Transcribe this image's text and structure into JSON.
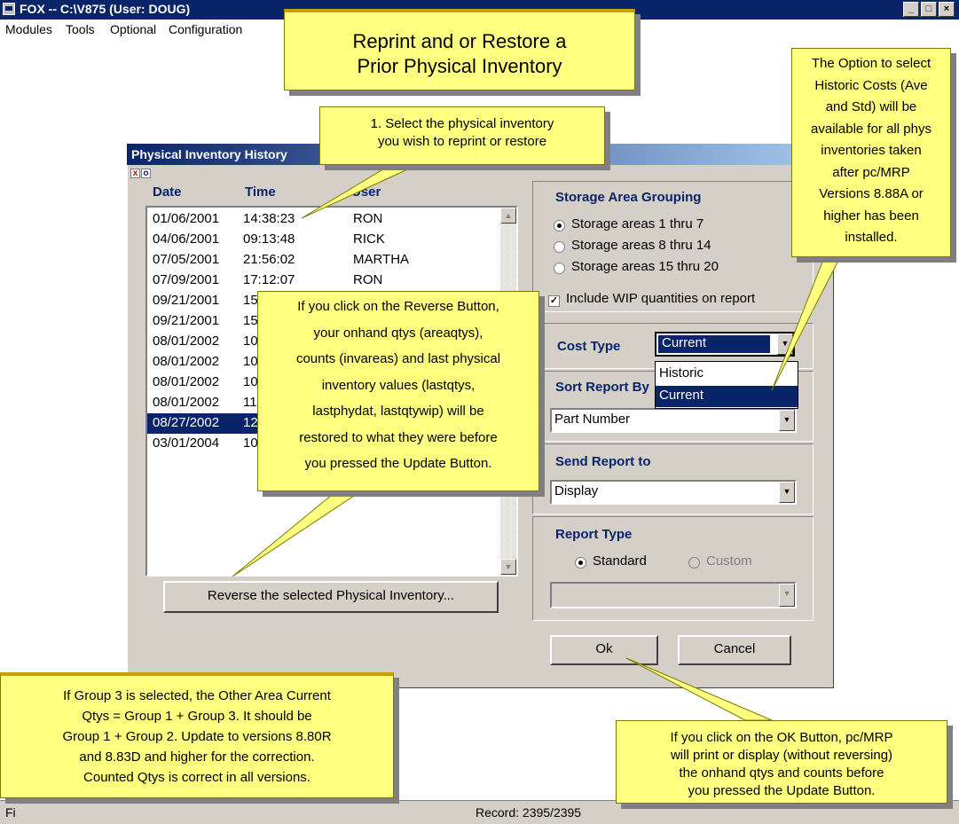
{
  "window": {
    "title": "FOX -- C:\\V875  (User: DOUG)"
  },
  "menu": {
    "items": [
      "Modules",
      "Tools",
      "Optional",
      "Configuration"
    ]
  },
  "dialog": {
    "title": "Physical Inventory History",
    "columns": {
      "date": "Date",
      "time": "Time",
      "user": "User"
    },
    "rows": [
      {
        "date": "01/06/2001",
        "time": "14:38:23",
        "user": "RON"
      },
      {
        "date": "04/06/2001",
        "time": "09:13:48",
        "user": "RICK"
      },
      {
        "date": "07/05/2001",
        "time": "21:56:02",
        "user": "MARTHA"
      },
      {
        "date": "07/09/2001",
        "time": "17:12:07",
        "user": "RON"
      },
      {
        "date": "09/21/2001",
        "time": "15",
        "user": ""
      },
      {
        "date": "09/21/2001",
        "time": "15",
        "user": ""
      },
      {
        "date": "08/01/2002",
        "time": "10",
        "user": ""
      },
      {
        "date": "08/01/2002",
        "time": "10",
        "user": ""
      },
      {
        "date": "08/01/2002",
        "time": "10",
        "user": ""
      },
      {
        "date": "08/01/2002",
        "time": "11",
        "user": ""
      },
      {
        "date": "08/27/2002",
        "time": "12",
        "user": ""
      },
      {
        "date": "03/01/2004",
        "time": "10",
        "user": ""
      }
    ],
    "selected_row": 10,
    "reverse_button": "Reverse the selected Physical Inventory...",
    "storage": {
      "heading": "Storage Area Grouping",
      "options": [
        "Storage areas 1 thru 7",
        "Storage areas 8 thru 14",
        "Storage areas 15 thru 20"
      ],
      "selected": 0
    },
    "include_wip": {
      "label": "Include WIP quantities on report",
      "checked": true
    },
    "cost_type": {
      "label": "Cost Type",
      "value": "Current",
      "options": [
        "Historic",
        "Current"
      ]
    },
    "sort": {
      "heading": "Sort Report By",
      "value": "Part Number"
    },
    "send": {
      "heading": "Send Report to",
      "value": "Display"
    },
    "report_type": {
      "heading": "Report Type",
      "standard": "Standard",
      "custom": "Custom",
      "selected": "Standard",
      "value": ""
    },
    "ok_button": "Ok",
    "cancel_button": "Cancel"
  },
  "status": {
    "left": "Fi",
    "record": "Record: 2395/2395"
  },
  "callouts": {
    "title_lines": [
      "Reprint and or Restore a",
      "Prior Physical Inventory"
    ],
    "select_lines": [
      "1. Select the physical inventory",
      "you wish to reprint or restore"
    ],
    "historic_lines": [
      "The Option to select",
      "Historic Costs (Ave",
      "and Std) will be",
      "available for all phys",
      "inventories taken",
      "after pc/MRP",
      "Versions 8.88A or",
      "higher has been",
      "installed."
    ],
    "reverse_lines": [
      "If you click on the Reverse Button,",
      "your onhand qtys (areaqtys),",
      "counts (invareas) and last physical",
      "inventory values (lastqtys,",
      "lastphydat, lastqtywip) will be",
      "restored to what they were before",
      "you pressed the Update Button."
    ],
    "group3_lines": [
      "If Group 3 is selected, the Other Area Current",
      "Qtys = Group 1 + Group 3.  It should be",
      "Group 1 + Group 2.  Update to versions 8.80R",
      "and 8.83D and higher for the correction.",
      "Counted Qtys is correct in all versions."
    ],
    "ok_lines": [
      "If you click on the OK Button, pc/MRP",
      "will print or display (without reversing)",
      "the onhand qtys and counts before",
      "you pressed the Update Button."
    ]
  },
  "colors": {
    "title_blue": "#0a246a",
    "callout_yellow": "#ffff80",
    "dialog_gray": "#d4d0c8"
  }
}
